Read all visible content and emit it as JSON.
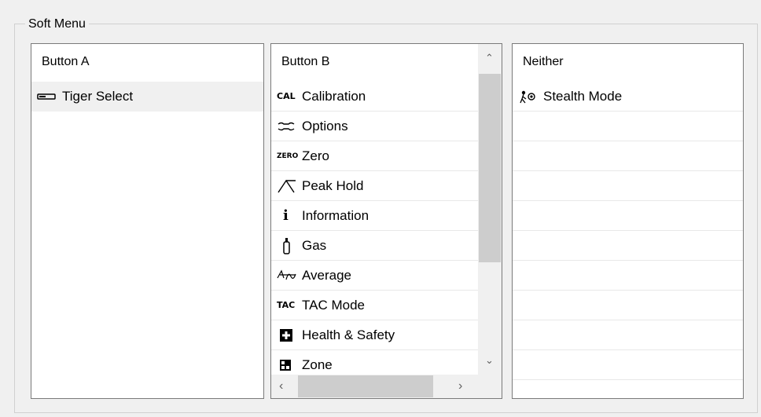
{
  "group": {
    "title": "Soft Menu"
  },
  "list_a": {
    "header": "Button A",
    "items": [
      {
        "label": "Tiger Select",
        "icon": "tiger-select-icon"
      }
    ]
  },
  "list_b": {
    "header": "Button B",
    "items": [
      {
        "label": "Calibration",
        "icon": "cal-icon",
        "icon_text": "CAL"
      },
      {
        "label": "Options",
        "icon": "wrench-icon"
      },
      {
        "label": "Zero",
        "icon": "zero-icon",
        "icon_text": "ZERO"
      },
      {
        "label": "Peak Hold",
        "icon": "peak-icon"
      },
      {
        "label": "Information",
        "icon": "info-icon",
        "icon_text": "i"
      },
      {
        "label": "Gas",
        "icon": "gas-cylinder-icon"
      },
      {
        "label": "Average",
        "icon": "average-icon"
      },
      {
        "label": "TAC Mode",
        "icon": "tac-icon",
        "icon_text": "TAC"
      },
      {
        "label": "Health & Safety",
        "icon": "first-aid-icon"
      },
      {
        "label": "Zone",
        "icon": "zone-icon"
      }
    ]
  },
  "list_c": {
    "header": "Neither",
    "items": [
      {
        "label": "Stealth Mode",
        "icon": "stealth-icon"
      }
    ],
    "empty_rows": 9
  }
}
